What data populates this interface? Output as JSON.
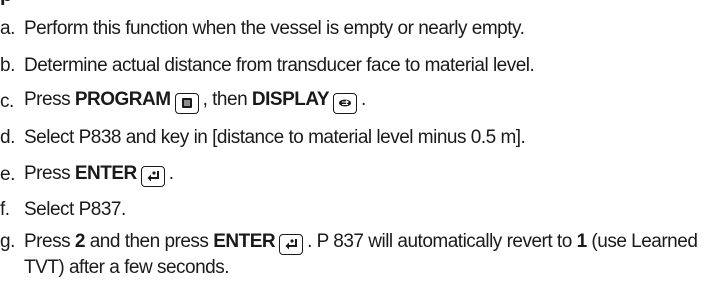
{
  "heading": "p",
  "steps": [
    {
      "letter": "a.",
      "text": "Perform this function when the vessel is empty or nearly empty."
    },
    {
      "letter": "b.",
      "text": "Determine actual distance from transducer face to material level."
    },
    {
      "letter": "c.",
      "pre": "Press ",
      "key1": "PROGRAM",
      "mid": ", then ",
      "key2": "DISPLAY",
      "post": "."
    },
    {
      "letter": "d.",
      "text": "Select P838 and key in [distance to material level minus 0.5 m]."
    },
    {
      "letter": "e.",
      "pre": "Press ",
      "key1": "ENTER",
      "post": "."
    },
    {
      "letter": "f.",
      "text": "Select P837."
    },
    {
      "letter": "g.",
      "pre": "Press ",
      "num": "2",
      "mid": " and then press ",
      "key1": "ENTER",
      "post1": ". P 837 will automatically revert to ",
      "num2": "1",
      "post2": " (use Learned TVT) after a few seconds."
    }
  ],
  "icons": {
    "program": "program-key-icon",
    "display": "display-key-icon",
    "enter": "enter-key-icon"
  }
}
